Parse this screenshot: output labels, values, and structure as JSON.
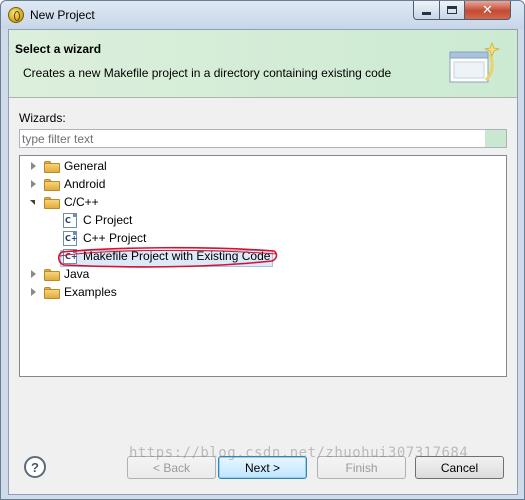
{
  "window": {
    "title": "New Project"
  },
  "banner": {
    "title": "Select a wizard",
    "description": "Creates a new Makefile project in a directory containing existing code"
  },
  "wizards": {
    "label": "Wizards:",
    "filter_placeholder": "type filter text",
    "filter_value": ""
  },
  "tree": [
    {
      "label": "General",
      "expanded": false,
      "icon": "folder-icon"
    },
    {
      "label": "Android",
      "expanded": false,
      "icon": "folder-icon"
    },
    {
      "label": "C/C++",
      "expanded": true,
      "icon": "folder-icon",
      "children": [
        {
          "label": "C Project",
          "icon": "c-project-icon",
          "glyph": "C"
        },
        {
          "label": "C++ Project",
          "icon": "cpp-project-icon",
          "glyph": "C+"
        },
        {
          "label": "Makefile Project with Existing Code",
          "icon": "makefile-project-icon",
          "glyph": "C+",
          "selected": true
        }
      ]
    },
    {
      "label": "Java",
      "expanded": false,
      "icon": "folder-icon"
    },
    {
      "label": "Examples",
      "expanded": false,
      "icon": "folder-icon"
    }
  ],
  "buttons": {
    "help": "?",
    "back": "< Back",
    "next": "Next >",
    "finish": "Finish",
    "cancel": "Cancel"
  },
  "watermark": "https://blog.csdn.net/zhuohui307317684",
  "colors": {
    "banner_bg": "#d6eed9",
    "selection": "#dbe9f8",
    "annotation_red": "#d8102c"
  }
}
